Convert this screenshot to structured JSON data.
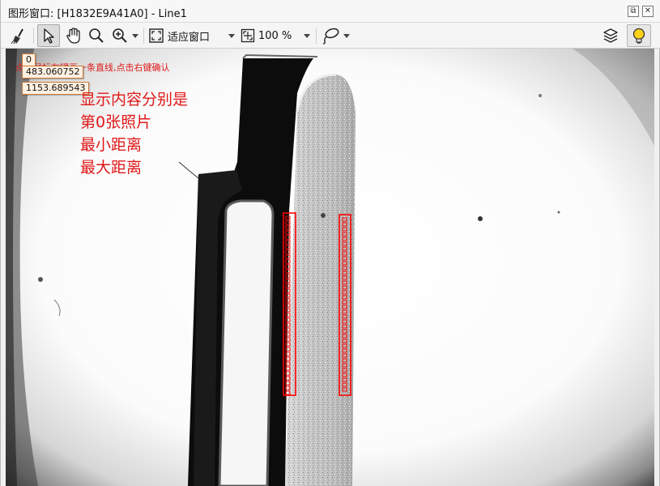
{
  "window": {
    "title": "图形窗口: [H1832E9A41A0] - Line1",
    "restore_glyph": "⧉",
    "close_glyph": "✕"
  },
  "toolbar": {
    "tools": [
      {
        "name": "clear-brush-icon"
      },
      {
        "name": "pointer-select-icon"
      },
      {
        "name": "hand-pan-icon"
      },
      {
        "name": "magnifier-icon"
      },
      {
        "name": "zoom-in-icon"
      },
      {
        "name": "fit-window-icon"
      },
      {
        "name": "zoom-percent-icon"
      },
      {
        "name": "lasso-icon"
      },
      {
        "name": "layers-icon"
      },
      {
        "name": "lightbulb-icon"
      }
    ],
    "fit_label": "适应窗口",
    "zoom_label": "100 %"
  },
  "canvas": {
    "hint": "点击鼠标左键画一条直线,点击右键确认",
    "tags": [
      "0",
      "483.060752",
      "1153.689543"
    ],
    "notes": [
      "显示内容分别是",
      "第0张照片",
      "最小距离",
      "最大距离"
    ],
    "colors": {
      "annotation": "#e01818",
      "tag_bg": "#fff0e0",
      "roi_outline": "#ff0000",
      "roi_marker": "#ffd21a"
    }
  }
}
